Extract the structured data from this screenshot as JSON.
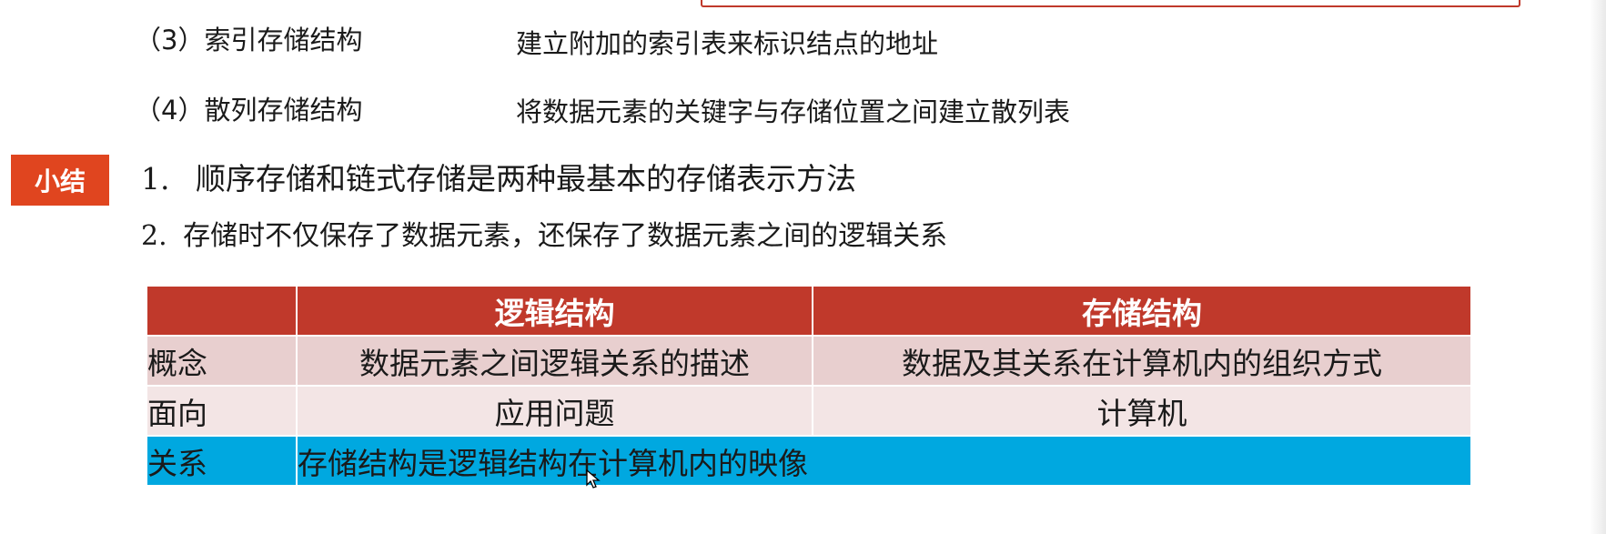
{
  "storage_types": [
    {
      "label": "（3）索引存储结构",
      "desc": "建立附加的索引表来标识结点的地址"
    },
    {
      "label": "（4）散列存储结构",
      "desc": "将数据元素的关键字与存储位置之间建立散列表"
    }
  ],
  "summary": {
    "badge": "小结",
    "items": [
      {
        "num": "1.",
        "text": "顺序存储和链式存储是两种最基本的存储表示方法"
      },
      {
        "num": "2.",
        "text": "存储时不仅保存了数据元素，还保存了数据元素之间的逻辑关系"
      }
    ]
  },
  "table": {
    "headers": [
      "",
      "逻辑结构",
      "存储结构"
    ],
    "rows": [
      {
        "label": "概念",
        "logical": "数据元素之间逻辑关系的描述",
        "storage": "数据及其关系在计算机内的组织方式"
      },
      {
        "label": "面向",
        "logical": "应用问题",
        "storage": "计算机"
      },
      {
        "label": "关系",
        "merged": "存储结构是逻辑结构在计算机内的映像"
      }
    ]
  },
  "colors": {
    "header_red": "#c0392b",
    "badge_orange": "#e0451f",
    "row1_pink": "#e8cfcf",
    "row2_pink": "#f3e5e5",
    "row3_blue": "#00a8e0"
  }
}
